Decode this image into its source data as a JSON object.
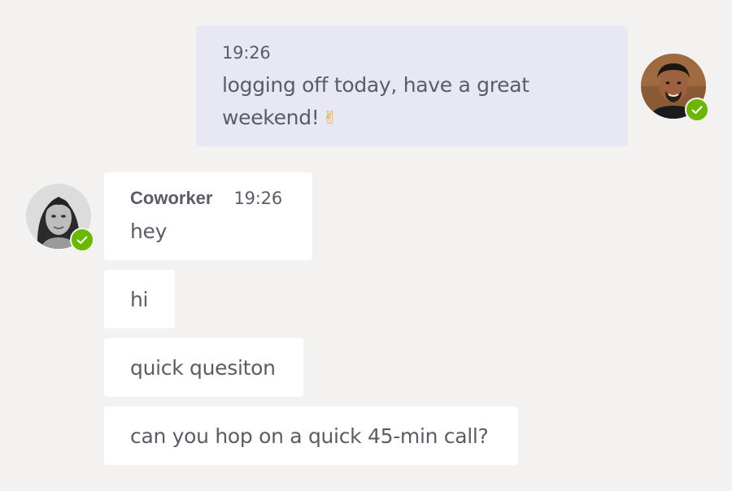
{
  "sent_message": {
    "time": "19:26",
    "text": "logging off today, have a great weekend!",
    "emoji_icon": "victory-hand-icon",
    "emoji": "✌"
  },
  "me": {
    "avatar_icon": "user-avatar-icon",
    "presence": "available",
    "presence_color": "#6bb700"
  },
  "coworker": {
    "name": "Coworker",
    "avatar_icon": "user-avatar-icon",
    "presence": "available",
    "presence_color": "#6bb700"
  },
  "received_messages": [
    {
      "sender": "Coworker",
      "time": "19:26",
      "text": "hey"
    },
    {
      "text": "hi"
    },
    {
      "text": "quick quesiton"
    },
    {
      "text": "can you hop on a quick 45-min call?"
    }
  ],
  "colors": {
    "background": "#f3f2f1",
    "sent_bubble": "#e8e8f5",
    "received_bubble": "#ffffff",
    "text": "#5c5c66"
  }
}
